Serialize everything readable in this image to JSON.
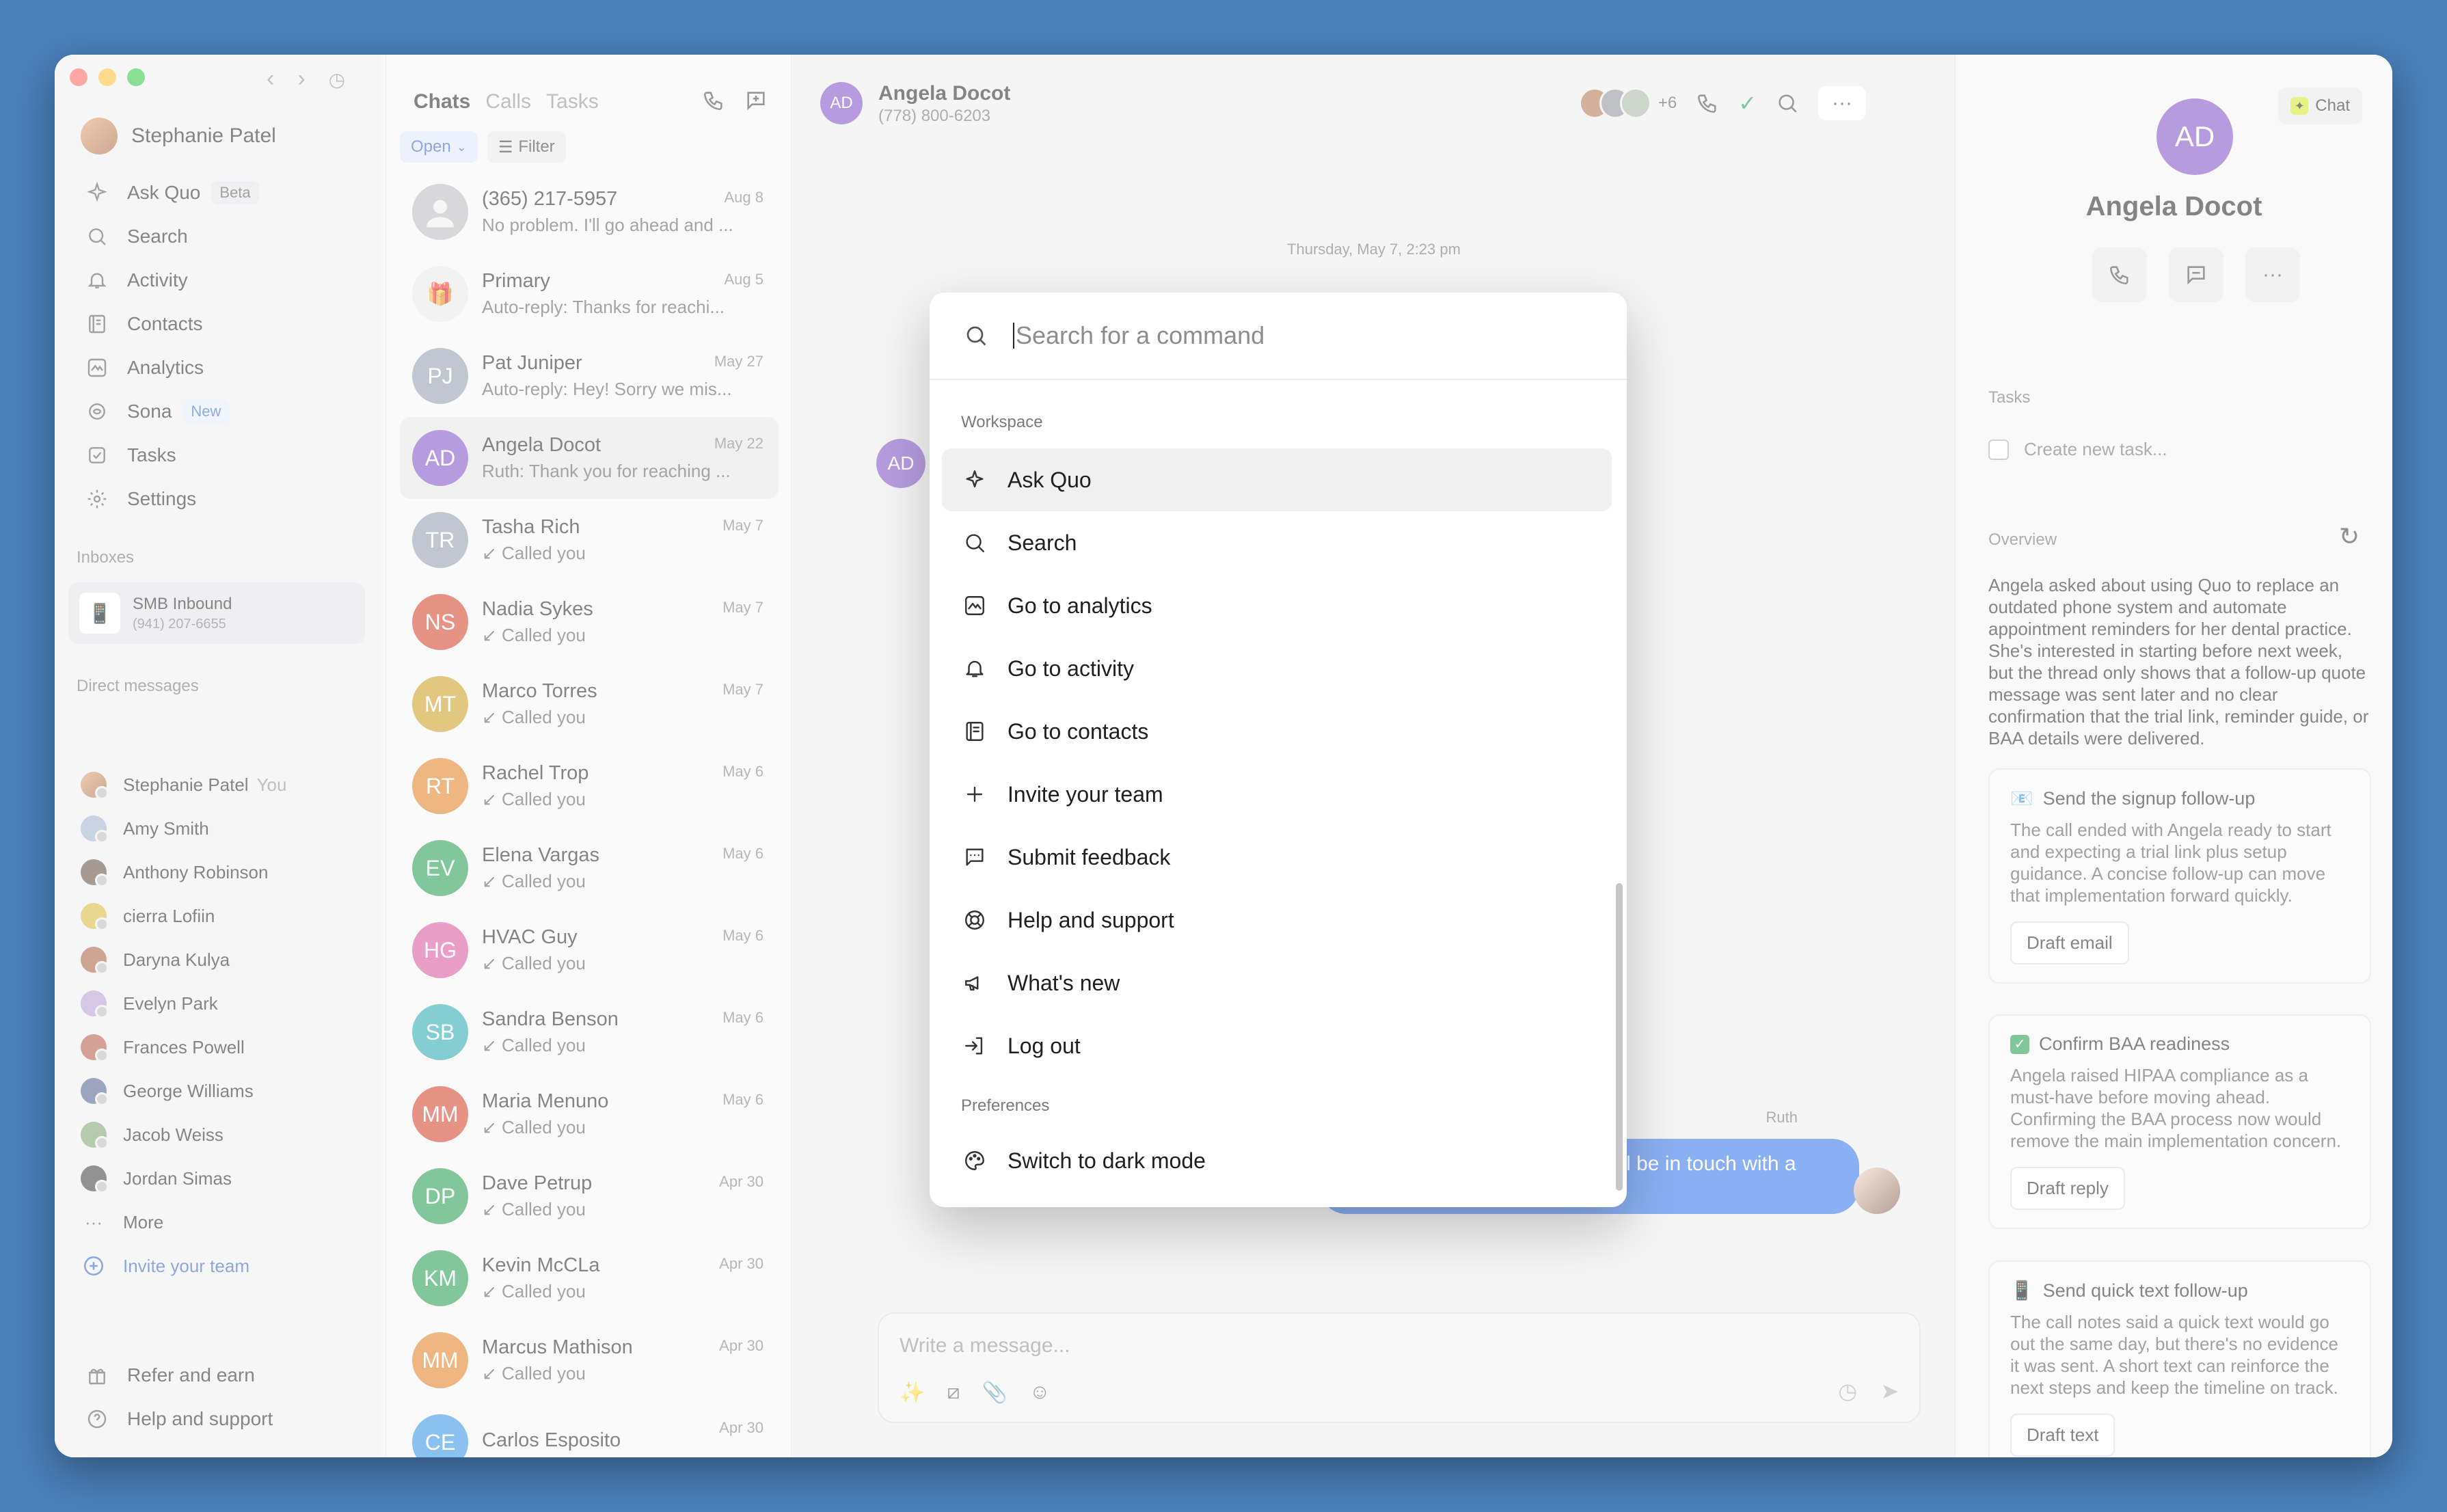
{
  "window": {
    "user_name": "Stephanie Patel"
  },
  "sidebar": {
    "nav": [
      {
        "label": "Ask Quo",
        "badge": "Beta",
        "icon": "sparkle-icon"
      },
      {
        "label": "Search",
        "icon": "search-icon"
      },
      {
        "label": "Activity",
        "icon": "bell-icon"
      },
      {
        "label": "Contacts",
        "icon": "contacts-icon"
      },
      {
        "label": "Analytics",
        "icon": "analytics-icon"
      },
      {
        "label": "Sona",
        "badge": "New",
        "icon": "sona-icon"
      },
      {
        "label": "Tasks",
        "icon": "tasks-icon"
      },
      {
        "label": "Settings",
        "icon": "gear-icon"
      }
    ],
    "inboxes_label": "Inboxes",
    "inbox": {
      "name": "SMB Inbound",
      "phone": "(941) 207-6655"
    },
    "dm_label": "Direct messages",
    "dms": [
      {
        "name": "Stephanie Patel",
        "suffix": "You"
      },
      {
        "name": "Amy Smith"
      },
      {
        "name": "Anthony Robinson"
      },
      {
        "name": "cierra Lofiin"
      },
      {
        "name": "Daryna Kulya"
      },
      {
        "name": "Evelyn Park"
      },
      {
        "name": "Frances Powell"
      },
      {
        "name": "George Williams"
      },
      {
        "name": "Jacob Weiss"
      },
      {
        "name": "Jordan Simas"
      }
    ],
    "more_label": "More",
    "invite_label": "Invite your team",
    "refer_label": "Refer and earn",
    "help_label": "Help and support"
  },
  "chatlist": {
    "tabs": [
      "Chats",
      "Calls",
      "Tasks"
    ],
    "open_label": "Open",
    "filter_label": "Filter",
    "conversations": [
      {
        "name": "(365) 217-5957",
        "date": "Aug 8",
        "preview": "No problem. I'll go ahead and ...",
        "initials": "",
        "color": "#b9b9bd"
      },
      {
        "name": "Primary",
        "date": "Aug 5",
        "preview": "Auto-reply: Thanks for reachi...",
        "initials": "🎁",
        "color": "#e7e7e9"
      },
      {
        "name": "Pat Juniper",
        "date": "May 27",
        "preview": "Auto-reply: Hey! Sorry we mis...",
        "initials": "PJ",
        "color": "#8e99ab"
      },
      {
        "name": "Angela Docot",
        "date": "May 22",
        "preview": "Ruth: Thank you for reaching ...",
        "initials": "AD",
        "color": "#7b4cc4"
      },
      {
        "name": "Tasha Rich",
        "date": "May 7",
        "preview": "Called you",
        "initials": "TR",
        "color": "#8e99ab"
      },
      {
        "name": "Nadia Sykes",
        "date": "May 7",
        "preview": "Called you",
        "initials": "NS",
        "color": "#d23a22"
      },
      {
        "name": "Marco Torres",
        "date": "May 7",
        "preview": "Called you",
        "initials": "MT",
        "color": "#c99a16"
      },
      {
        "name": "Rachel Trop",
        "date": "May 6",
        "preview": "Called you",
        "initials": "RT",
        "color": "#e07a1a"
      },
      {
        "name": "Elena Vargas",
        "date": "May 6",
        "preview": "Called you",
        "initials": "EV",
        "color": "#1a9a4a"
      },
      {
        "name": "HVAC Guy",
        "date": "May 6",
        "preview": "Called you",
        "initials": "HG",
        "color": "#d84f9c"
      },
      {
        "name": "Sandra Benson",
        "date": "May 6",
        "preview": "Called you",
        "initials": "SB",
        "color": "#1fa7b0"
      },
      {
        "name": "Maria Menuno",
        "date": "May 6",
        "preview": "Called you",
        "initials": "MM",
        "color": "#d23a22"
      },
      {
        "name": "Dave Petrup",
        "date": "Apr 30",
        "preview": "Called you",
        "initials": "DP",
        "color": "#1a9a4a"
      },
      {
        "name": "Kevin McCLa",
        "date": "Apr 30",
        "preview": "Called you",
        "initials": "KM",
        "color": "#1a9a4a"
      },
      {
        "name": "Marcus Mathison",
        "date": "Apr 30",
        "preview": "Called you",
        "initials": "MM",
        "color": "#e07a1a"
      },
      {
        "name": "Carlos Esposito",
        "date": "Apr 30",
        "preview": "",
        "initials": "CE",
        "color": "#2a8ee0"
      }
    ]
  },
  "main": {
    "contact_initials": "AD",
    "contact_name": "Angela Docot",
    "contact_phone": "(778) 800-6203",
    "participants_more": "+6",
    "date_separator": "Thursday, May 7, 2:23 pm",
    "sender_label": "Ruth",
    "bubble_text": "e'll be in touch with a",
    "composer_placeholder": "Write a message..."
  },
  "right": {
    "chat_button": "Chat",
    "initials": "AD",
    "name": "Angela Docot",
    "tasks_label": "Tasks",
    "new_task": "Create new task...",
    "overview_label": "Overview",
    "overview_text": "Angela asked about using Quo to replace an outdated phone system and automate appointment reminders for her dental practice. She's interested in starting before next week, but the thread only shows that a follow-up quote message was sent later and no clear confirmation that the trial link, reminder guide, or BAA details were delivered.",
    "cards": [
      {
        "title": "Send the signup follow-up",
        "body": "The call ended with Angela ready to start and expecting a trial link plus setup guidance. A concise follow-up can move that implementation forward quickly.",
        "button": "Draft email"
      },
      {
        "title": "Confirm BAA readiness",
        "body": "Angela raised HIPAA compliance as a must-have before moving ahead. Confirming the BAA process now would remove the main implementation concern.",
        "button": "Draft reply"
      },
      {
        "title": "Send quick text follow-up",
        "body": "The call notes said a quick text would go out the same day, but there's no evidence it was sent. A short text can reinforce the next steps and keep the timeline on track.",
        "button": "Draft text"
      }
    ]
  },
  "palette": {
    "placeholder": "Search for a command",
    "workspace_label": "Workspace",
    "workspace_items": [
      {
        "label": "Ask Quo",
        "icon": "sparkle-icon"
      },
      {
        "label": "Search",
        "icon": "search-icon"
      },
      {
        "label": "Go to analytics",
        "icon": "analytics-icon"
      },
      {
        "label": "Go to activity",
        "icon": "bell-icon"
      },
      {
        "label": "Go to contacts",
        "icon": "contacts-icon"
      },
      {
        "label": "Invite your team",
        "icon": "plus-icon"
      },
      {
        "label": "Submit feedback",
        "icon": "feedback-icon"
      },
      {
        "label": "Help and support",
        "icon": "lifebuoy-icon"
      },
      {
        "label": "What's new",
        "icon": "megaphone-icon"
      },
      {
        "label": "Log out",
        "icon": "logout-icon"
      }
    ],
    "preferences_label": "Preferences",
    "preferences_items": [
      {
        "label": "Switch to dark mode",
        "icon": "palette-icon"
      }
    ]
  }
}
